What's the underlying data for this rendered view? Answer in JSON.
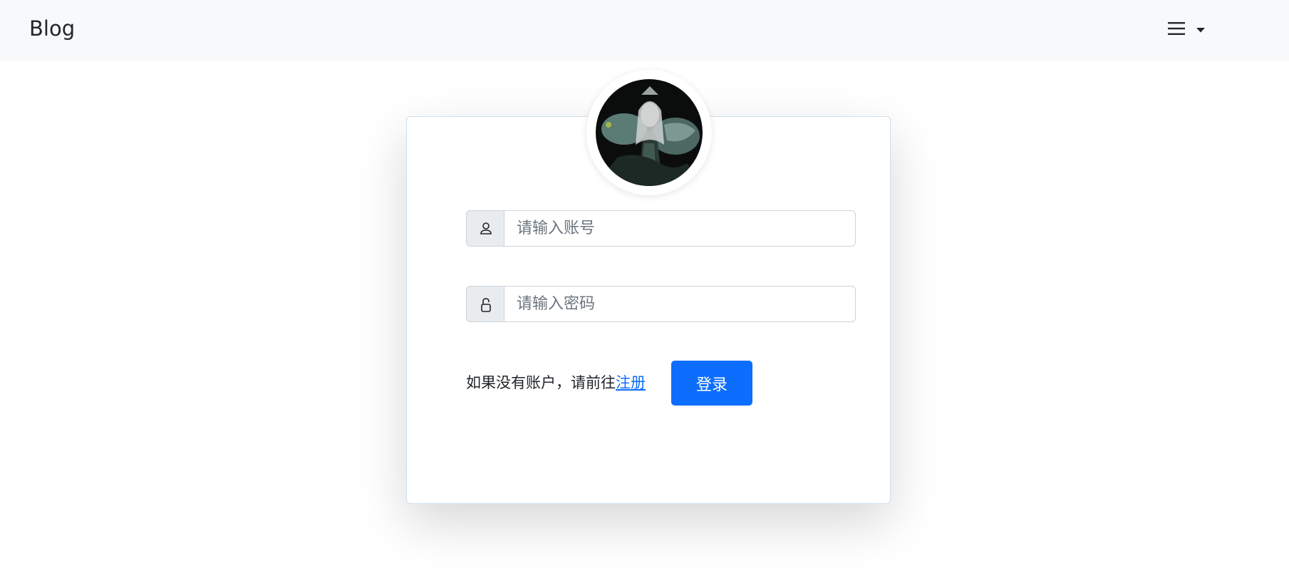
{
  "navbar": {
    "brand": "Blog",
    "menu_icon": "hamburger-icon",
    "dropdown_icon": "caret-down-icon"
  },
  "avatar": {
    "alt": "user avatar"
  },
  "form": {
    "account": {
      "icon": "user-icon",
      "placeholder": "请输入账号",
      "value": ""
    },
    "password": {
      "icon": "lock-icon",
      "placeholder": "请输入密码",
      "value": ""
    },
    "register_prompt": "如果没有账户，请前往",
    "register_link": "注册",
    "login_button": "登录"
  },
  "colors": {
    "navbar_bg": "#f8f9fa",
    "primary": "#0d6efd",
    "addon_bg": "#e9ecef",
    "border": "#ced4da"
  }
}
